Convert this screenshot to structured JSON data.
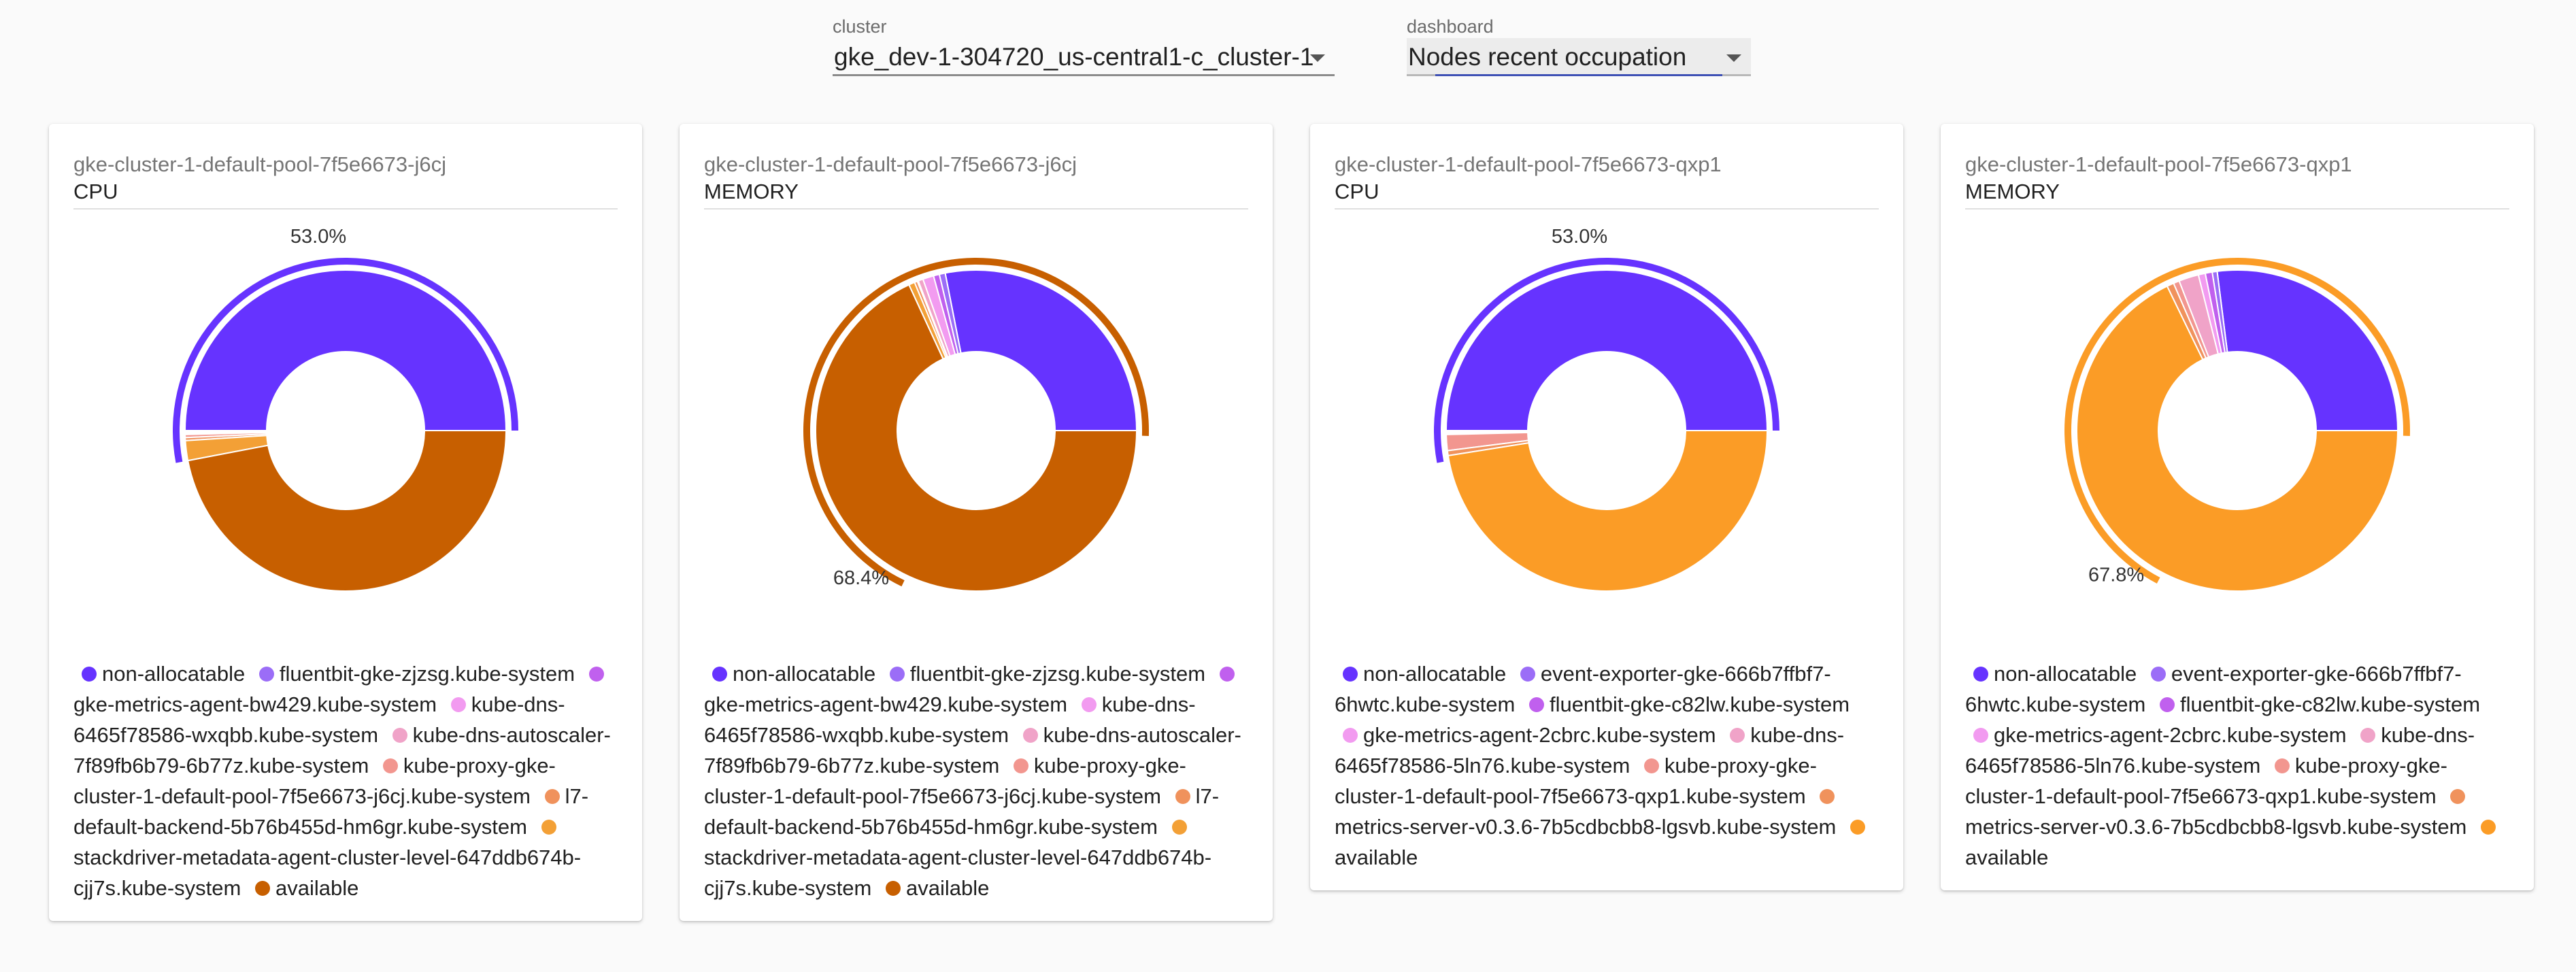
{
  "controls": {
    "cluster_label": "cluster",
    "cluster_value": "gke_dev-1-304720_us-central1-c_cluster-1",
    "dashboard_label": "dashboard",
    "dashboard_value": "Nodes recent occupation"
  },
  "colors": {
    "non_allocatable": "#6633ff",
    "fluentbit": "#9b6df7",
    "gke_metrics_agent": "#c060ee",
    "kube_dns": "#f29bf0",
    "kube_dns_autoscaler": "#f0a3c8",
    "kube_proxy": "#f2968f",
    "l7_default_backend": "#f0925c",
    "stackdriver": "#f3a036",
    "available_dark": "#c75f00",
    "available_light": "#fb9c26"
  },
  "chart_data": [
    {
      "type": "pie",
      "node": "gke-cluster-1-default-pool-7f5e6673-j6cj",
      "resource": "CPU",
      "highlight_label": "53.0%",
      "highlight_fraction": 0.53,
      "slices": [
        {
          "name": "non-allocatable",
          "value": 50.0,
          "color": "#6633ff"
        },
        {
          "name": "fluentbit-gke-zjzsg.kube-system",
          "value": 0.1,
          "color": "#9b6df7"
        },
        {
          "name": "gke-metrics-agent-bw429.kube-system",
          "value": 0.1,
          "color": "#c060ee"
        },
        {
          "name": "kube-dns-6465f78586-wxqbb.kube-system",
          "value": 0.1,
          "color": "#f29bf0"
        },
        {
          "name": "kube-dns-autoscaler-7f89fb6b79-6b77z.kube-system",
          "value": 0.1,
          "color": "#f0a3c8"
        },
        {
          "name": "kube-proxy-gke-cluster-1-default-pool-7f5e6673-j6cj.kube-system",
          "value": 0.3,
          "color": "#f2968f"
        },
        {
          "name": "l7-default-backend-5b76b455d-hm6gr.kube-system",
          "value": 0.3,
          "color": "#f0925c"
        },
        {
          "name": "stackdriver-metadata-agent-cluster-level-647ddb674b-cjj7s.kube-system",
          "value": 2.0,
          "color": "#f3a036"
        },
        {
          "name": "available",
          "value": 47.0,
          "color": "#c75f00"
        }
      ]
    },
    {
      "type": "pie",
      "node": "gke-cluster-1-default-pool-7f5e6673-j6cj",
      "resource": "MEMORY",
      "highlight_label": "68.4%",
      "highlight_fraction": 0.684,
      "slices": [
        {
          "name": "non-allocatable",
          "value": 28.2,
          "color": "#6633ff"
        },
        {
          "name": "fluentbit-gke-zjzsg.kube-system",
          "value": 0.6,
          "color": "#9b6df7"
        },
        {
          "name": "gke-metrics-agent-bw429.kube-system",
          "value": 0.6,
          "color": "#c060ee"
        },
        {
          "name": "kube-dns-6465f78586-wxqbb.kube-system",
          "value": 1.1,
          "color": "#f29bf0"
        },
        {
          "name": "kube-dns-autoscaler-7f89fb6b79-6b77z.kube-system",
          "value": 0.5,
          "color": "#f0a3c8"
        },
        {
          "name": "kube-proxy-gke-cluster-1-default-pool-7f5e6673-j6cj.kube-system",
          "value": 0.1,
          "color": "#f2968f"
        },
        {
          "name": "l7-default-backend-5b76b455d-hm6gr.kube-system",
          "value": 0.3,
          "color": "#f0925c"
        },
        {
          "name": "stackdriver-metadata-agent-cluster-level-647ddb674b-cjj7s.kube-system",
          "value": 0.6,
          "color": "#f3a036"
        },
        {
          "name": "available",
          "value": 68.4,
          "color": "#c75f00"
        }
      ]
    },
    {
      "type": "pie",
      "node": "gke-cluster-1-default-pool-7f5e6673-qxp1",
      "resource": "CPU",
      "highlight_label": "53.0%",
      "highlight_fraction": 0.53,
      "slices": [
        {
          "name": "non-allocatable",
          "value": 50.0,
          "color": "#6633ff"
        },
        {
          "name": "event-exporter-gke-666b7ffbf7-6hwtc.kube-system",
          "value": 0.1,
          "color": "#9b6df7"
        },
        {
          "name": "fluentbit-gke-c82lw.kube-system",
          "value": 0.1,
          "color": "#c060ee"
        },
        {
          "name": "gke-metrics-agent-2cbrc.kube-system",
          "value": 0.1,
          "color": "#f29bf0"
        },
        {
          "name": "kube-dns-6465f78586-5ln76.kube-system",
          "value": 0.1,
          "color": "#f0a3c8"
        },
        {
          "name": "kube-proxy-gke-cluster-1-default-pool-7f5e6673-qxp1.kube-system",
          "value": 1.6,
          "color": "#f2968f"
        },
        {
          "name": "metrics-server-v0.3.6-7b5cdbcbb8-lgsvb.kube-system",
          "value": 0.5,
          "color": "#f0925c"
        },
        {
          "name": "available",
          "value": 47.5,
          "color": "#fb9c26"
        }
      ]
    },
    {
      "type": "pie",
      "node": "gke-cluster-1-default-pool-7f5e6673-qxp1",
      "resource": "MEMORY",
      "highlight_label": "67.8%",
      "highlight_fraction": 0.678,
      "slices": [
        {
          "name": "non-allocatable",
          "value": 27.0,
          "color": "#6633ff"
        },
        {
          "name": "event-exporter-gke-666b7ffbf7-6hwtc.kube-system",
          "value": 0.5,
          "color": "#9b6df7"
        },
        {
          "name": "fluentbit-gke-c82lw.kube-system",
          "value": 0.7,
          "color": "#c060ee"
        },
        {
          "name": "gke-metrics-agent-2cbrc.kube-system",
          "value": 0.7,
          "color": "#f29bf0"
        },
        {
          "name": "kube-dns-6465f78586-5ln76.kube-system",
          "value": 2.0,
          "color": "#f0a3c8"
        },
        {
          "name": "kube-proxy-gke-cluster-1-default-pool-7f5e6673-qxp1.kube-system",
          "value": 0.6,
          "color": "#f2968f"
        },
        {
          "name": "metrics-server-v0.3.6-7b5cdbcbb8-lgsvb.kube-system",
          "value": 0.7,
          "color": "#f0925c"
        },
        {
          "name": "available",
          "value": 67.8,
          "color": "#fb9c26"
        }
      ]
    }
  ]
}
